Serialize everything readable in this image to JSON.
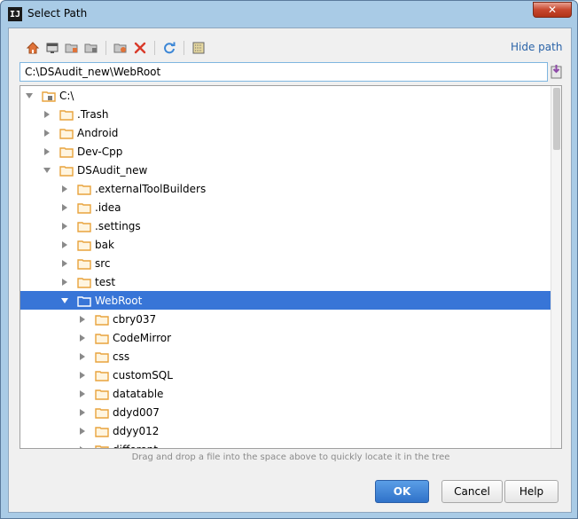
{
  "window": {
    "title": "Select Path",
    "app_icon_text": "IJ",
    "close_glyph": "✕"
  },
  "toolbar": {
    "icons": [
      "home-icon",
      "desktop-icon",
      "project-folder-icon",
      "module-folder-icon",
      "new-folder-icon",
      "delete-icon",
      "refresh-icon",
      "show-hidden-icon"
    ],
    "hide_path_label": "Hide path"
  },
  "path": {
    "value": "C:\\DSAudit_new\\WebRoot"
  },
  "tree": {
    "rows": [
      {
        "label": "C:\\",
        "depth": 0,
        "state": "expanded",
        "kind": "drive"
      },
      {
        "label": ".Trash",
        "depth": 1,
        "state": "collapsed",
        "kind": "folder"
      },
      {
        "label": "Android",
        "depth": 1,
        "state": "collapsed",
        "kind": "folder"
      },
      {
        "label": "Dev-Cpp",
        "depth": 1,
        "state": "collapsed",
        "kind": "folder"
      },
      {
        "label": "DSAudit_new",
        "depth": 1,
        "state": "expanded",
        "kind": "folder"
      },
      {
        "label": ".externalToolBuilders",
        "depth": 2,
        "state": "collapsed",
        "kind": "folder"
      },
      {
        "label": ".idea",
        "depth": 2,
        "state": "collapsed",
        "kind": "folder"
      },
      {
        "label": ".settings",
        "depth": 2,
        "state": "collapsed",
        "kind": "folder"
      },
      {
        "label": "bak",
        "depth": 2,
        "state": "collapsed",
        "kind": "folder"
      },
      {
        "label": "src",
        "depth": 2,
        "state": "collapsed",
        "kind": "folder"
      },
      {
        "label": "test",
        "depth": 2,
        "state": "collapsed",
        "kind": "folder"
      },
      {
        "label": "WebRoot",
        "depth": 2,
        "state": "expanded",
        "kind": "folder",
        "selected": true
      },
      {
        "label": "cbry037",
        "depth": 3,
        "state": "collapsed",
        "kind": "folder"
      },
      {
        "label": "CodeMirror",
        "depth": 3,
        "state": "collapsed",
        "kind": "folder"
      },
      {
        "label": "css",
        "depth": 3,
        "state": "collapsed",
        "kind": "folder"
      },
      {
        "label": "customSQL",
        "depth": 3,
        "state": "collapsed",
        "kind": "folder"
      },
      {
        "label": "datatable",
        "depth": 3,
        "state": "collapsed",
        "kind": "folder"
      },
      {
        "label": "ddyd007",
        "depth": 3,
        "state": "collapsed",
        "kind": "folder"
      },
      {
        "label": "ddyy012",
        "depth": 3,
        "state": "collapsed",
        "kind": "folder"
      },
      {
        "label": "different",
        "depth": 3,
        "state": "collapsed",
        "kind": "folder"
      }
    ]
  },
  "hint": "Drag and drop a file into the space above to quickly locate it in the tree",
  "buttons": {
    "ok": "OK",
    "cancel": "Cancel",
    "help": "Help"
  },
  "colors": {
    "selection": "#3875d7",
    "folder": "#e8a33d",
    "link": "#2a63a8"
  }
}
